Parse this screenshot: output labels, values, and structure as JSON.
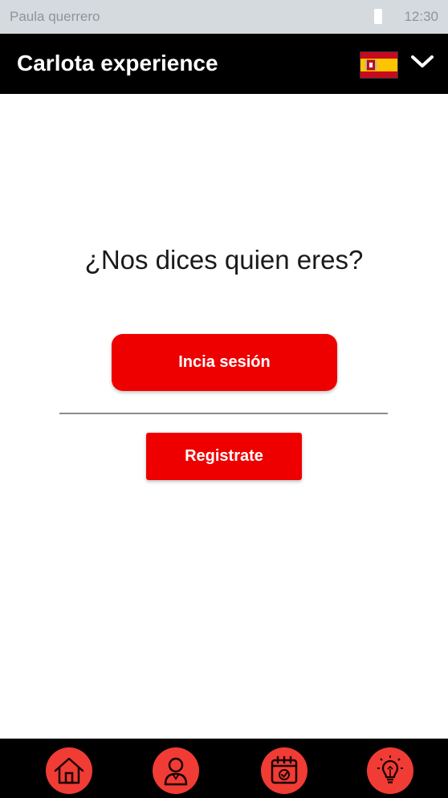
{
  "status_bar": {
    "carrier": "Paula querrero",
    "time": "12:30"
  },
  "header": {
    "title": "Carlota experience",
    "language_flag": "spain-flag-icon",
    "menu_icon": "chevron-down-icon"
  },
  "main": {
    "question": "¿Nos dices quien eres?",
    "login_label": "Incia sesión",
    "register_label": "Registrate"
  },
  "bottom_nav": {
    "items": [
      {
        "icon": "home-icon"
      },
      {
        "icon": "user-icon"
      },
      {
        "icon": "calendar-icon"
      },
      {
        "icon": "lightbulb-icon"
      }
    ]
  },
  "colors": {
    "accent_red": "#ef0000",
    "nav_circle": "#f03c35",
    "header_bg": "#000000",
    "status_bg": "#d4dade"
  }
}
